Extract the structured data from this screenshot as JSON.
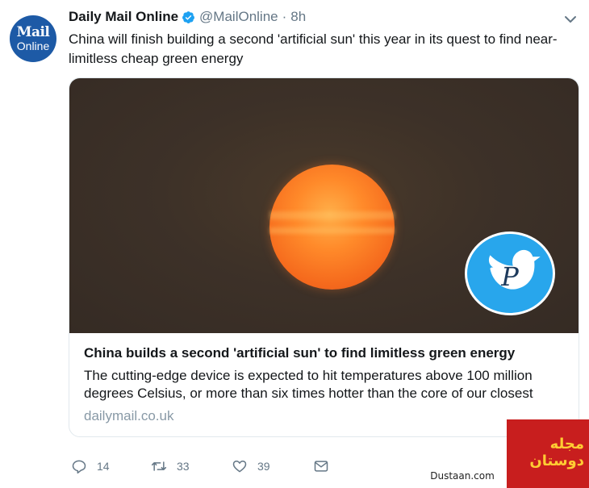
{
  "tweet": {
    "avatar": {
      "line1": "Mail",
      "line2": "Online"
    },
    "author_name": "Daily Mail Online",
    "handle": "@MailOnline",
    "separator": "·",
    "time": "8h",
    "text": "China will finish building a second 'artificial sun' this year in its quest to find near-limitless cheap green energy",
    "card": {
      "title": "China builds a second 'artificial sun' to find limitless green energy",
      "description": "The cutting-edge device is expected to hit temperatures above 100 million degrees Celsius, or more than six times hotter than the core of our closest",
      "domain": "dailymail.co.uk"
    },
    "actions": {
      "replies": "14",
      "retweets": "33",
      "likes": "39"
    }
  },
  "watermark": {
    "site": "Dustaan.com",
    "arabic": "مجله دوستان"
  },
  "colors": {
    "brand_blue": "#1da1f2",
    "avatar_blue": "#1d5aa6",
    "text": "#14171a",
    "muted": "#657786",
    "card_border": "#e1e8ed",
    "domain": "#8899a6"
  }
}
